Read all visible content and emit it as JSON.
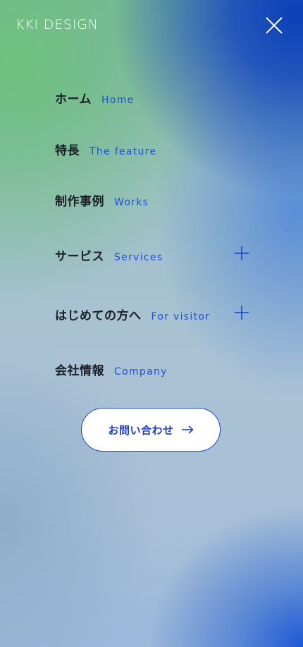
{
  "brand": {
    "logo_text": "KKI DESIGN"
  },
  "colors": {
    "accent": "#1f4fd6",
    "text": "#1b1e26",
    "button_bg": "#ffffff"
  },
  "icons": {
    "close": "close-icon",
    "expand": "plus-icon",
    "arrow": "arrow-right-icon"
  },
  "menu": {
    "items": [
      {
        "jp": "ホーム",
        "en": "Home",
        "expandable": false
      },
      {
        "jp": "特長",
        "en": "The feature",
        "expandable": false
      },
      {
        "jp": "制作事例",
        "en": "Works",
        "expandable": false
      },
      {
        "jp": "サービス",
        "en": "Services",
        "expandable": true
      },
      {
        "jp": "はじめての方へ",
        "en": "For visitor",
        "expandable": true
      },
      {
        "jp": "会社情報",
        "en": "Company",
        "expandable": false
      }
    ]
  },
  "contact": {
    "label": "お問い合わせ"
  }
}
